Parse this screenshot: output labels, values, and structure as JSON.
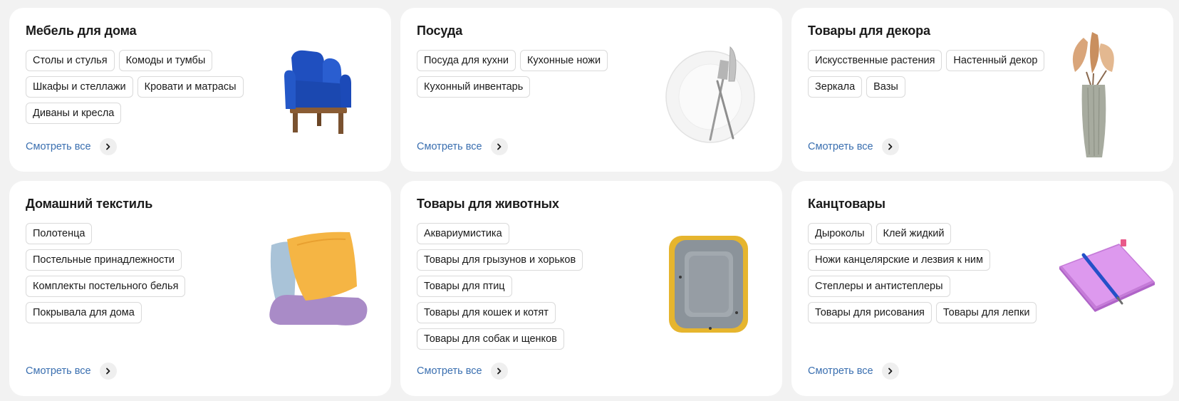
{
  "colors": {
    "page_background": "#f2f2f2",
    "card_background": "#ffffff",
    "link": "#3a6fb0",
    "chip_border": "#dadada"
  },
  "cards": [
    {
      "title": "Мебель для дома",
      "chips": [
        "Столы и стулья",
        "Комоды и тумбы",
        "Шкафы и стеллажи",
        "Кровати и матрасы",
        "Диваны и кресла"
      ],
      "see_all": "Смотреть все",
      "image": "armchair-icon"
    },
    {
      "title": "Посуда",
      "chips": [
        "Посуда для кухни",
        "Кухонные ножи",
        "Кухонный инвентарь"
      ],
      "see_all": "Смотреть все",
      "image": "plate-cutlery-icon"
    },
    {
      "title": "Товары для декора",
      "chips": [
        "Искусственные растения",
        "Настенный декор",
        "Зеркала",
        "Вазы"
      ],
      "see_all": "Смотреть все",
      "image": "vase-icon"
    },
    {
      "title": "Домашний текстиль",
      "chips": [
        "Полотенца",
        "Постельные принадлежности",
        "Комплекты постельного белья",
        "Покрывала для дома"
      ],
      "see_all": "Смотреть все",
      "image": "pillows-icon"
    },
    {
      "title": "Товары для животных",
      "chips": [
        "Аквариумистика",
        "Товары для грызунов и хорьков",
        "Товары для птиц",
        "Товары для кошек и котят",
        "Товары для собак и щенков"
      ],
      "see_all": "Смотреть все",
      "image": "pet-bed-icon"
    },
    {
      "title": "Канцтовары",
      "chips": [
        "Дыроколы",
        "Клей жидкий",
        "Ножи канцелярские и лезвия к ним",
        "Степлеры и антистеплеры",
        "Товары для рисования",
        "Товары для лепки"
      ],
      "see_all": "Смотреть все",
      "image": "notebook-pen-icon"
    }
  ]
}
